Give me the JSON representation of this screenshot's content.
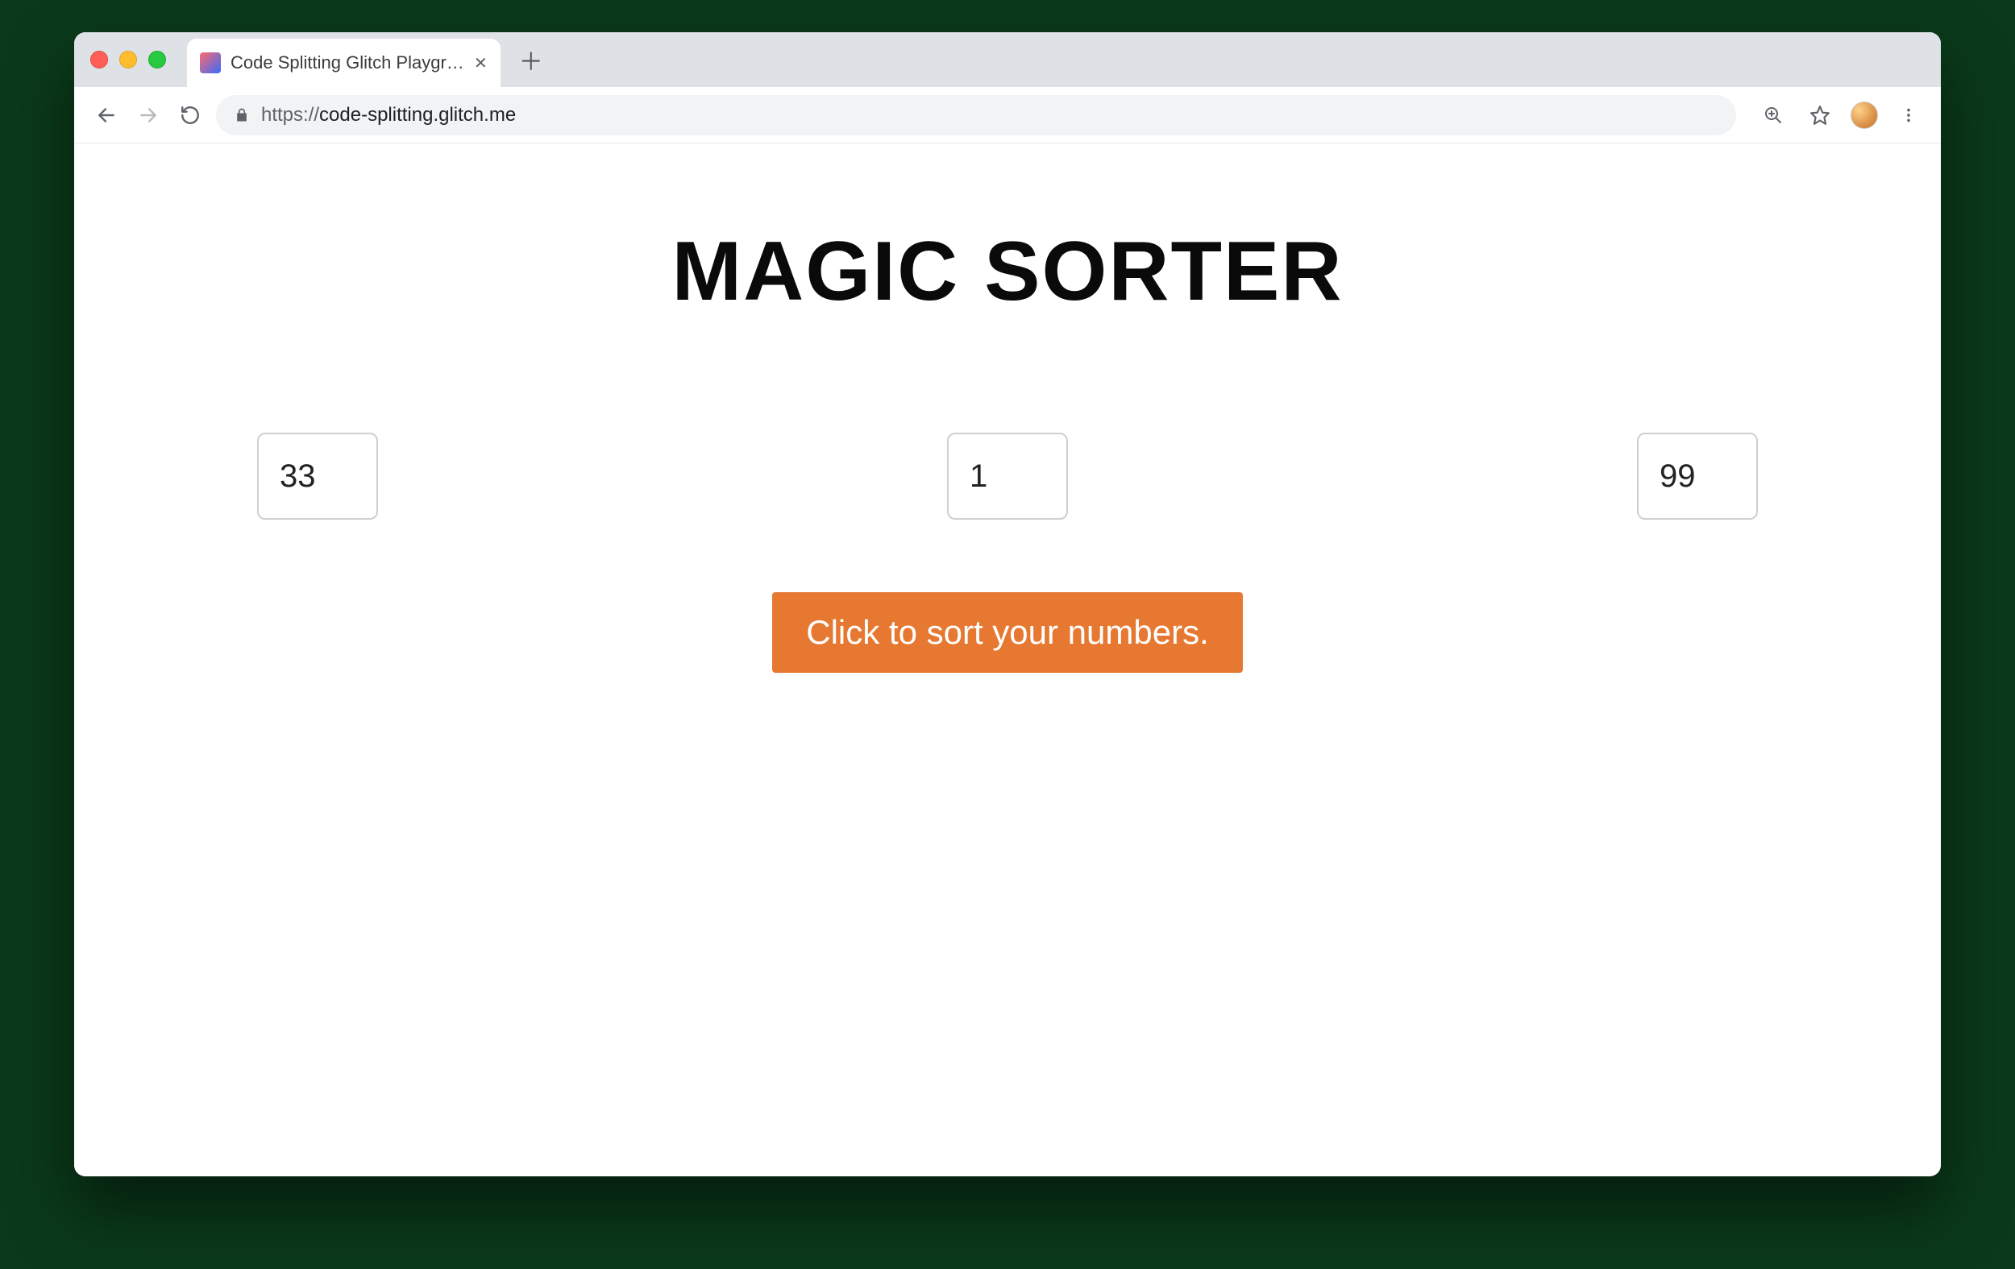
{
  "browser": {
    "tab": {
      "title": "Code Splitting Glitch Playgroun"
    },
    "url_prefix": "https://",
    "url_host": "code-splitting.glitch.me"
  },
  "page": {
    "heading": "MAGIC SORTER",
    "inputs": {
      "a": "33",
      "b": "1",
      "c": "99"
    },
    "button_label": "Click to sort your numbers."
  },
  "colors": {
    "accent": "#e67831"
  }
}
